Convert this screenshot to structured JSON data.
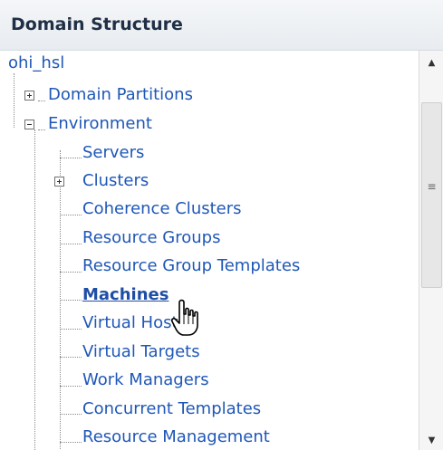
{
  "panel": {
    "title": "Domain Structure"
  },
  "tree": {
    "root": "ohi_hsl",
    "domain_partitions": "Domain Partitions",
    "environment": "Environment",
    "servers": "Servers",
    "clusters": "Clusters",
    "coherence_clusters": "Coherence Clusters",
    "resource_groups": "Resource Groups",
    "resource_group_templates": "Resource Group Templates",
    "machines": "Machines",
    "virtual_hosts": "Virtual Hosts",
    "virtual_targets": "Virtual Targets",
    "work_managers": "Work Managers",
    "concurrent_templates": "Concurrent Templates",
    "resource_management": "Resource Management"
  },
  "scrollbar": {
    "up_icon": "triangle-up-icon",
    "down_icon": "triangle-down-icon",
    "grip_icon": "grip-icon"
  },
  "colors": {
    "link": "#1f57b7",
    "header_text": "#1f2f45",
    "header_bg": "#eef1f4"
  }
}
